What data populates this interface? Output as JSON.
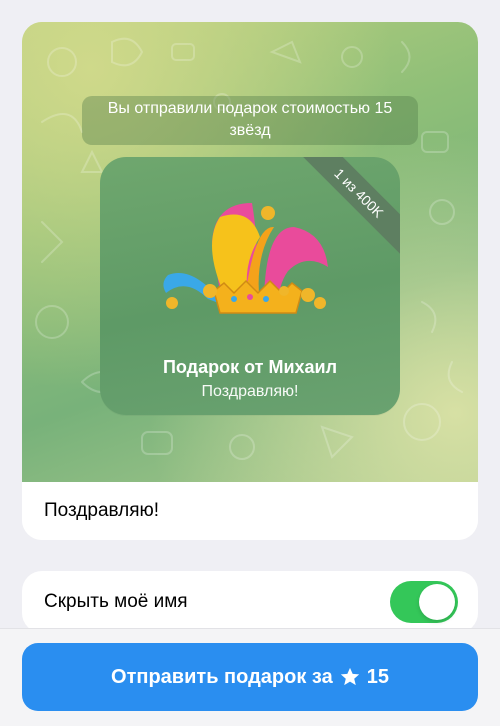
{
  "preview": {
    "service_message": "Вы отправили подарок стоимостью 15 звёзд",
    "gift": {
      "ribbon": "1 из 400K",
      "title": "Подарок от Михаил",
      "subtitle": "Поздравляю!",
      "image": "jester-hat"
    },
    "message": "Поздравляю!"
  },
  "options": {
    "hide_name_label": "Скрыть моё имя",
    "hide_name_enabled": true
  },
  "send_button": {
    "label": "Отправить подарок за",
    "star_icon": "star-icon",
    "amount": "15"
  },
  "colors": {
    "accent": "#2a8ef0",
    "toggle_on": "#34c759",
    "bubble": "#5e9a66"
  }
}
